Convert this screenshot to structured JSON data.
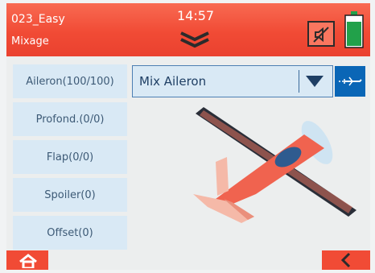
{
  "header": {
    "model_name": "023_Easy",
    "screen_name": "Mixage",
    "time": "14:57",
    "menu_icon": "double-chevron-down-icon",
    "sound_icon": "speaker-muted-icon",
    "battery_icon": "battery-icon",
    "battery_level": 0.8
  },
  "sidebar": {
    "items": [
      {
        "label": "Aileron(100/100)"
      },
      {
        "label": "Profond.(0/0)"
      },
      {
        "label": "Flap(0/0)"
      },
      {
        "label": "Spoiler(0)"
      },
      {
        "label": "Offset(0)"
      }
    ]
  },
  "mix_select": {
    "value": "Mix Aileron",
    "icon": "dropdown-arrow-icon"
  },
  "plane_button_icon": "airplane-icon",
  "illustration_icon": "airplane-illustration",
  "footer": {
    "home_icon": "home-icon",
    "back_icon": "chevron-left-icon"
  },
  "colors": {
    "header_red": "#f14b35",
    "button_blue": "#0a66b6",
    "sidebar_blue": "#d9e9f5",
    "plane_red": "#f0634f",
    "wing_dark": "#2a2e38"
  }
}
